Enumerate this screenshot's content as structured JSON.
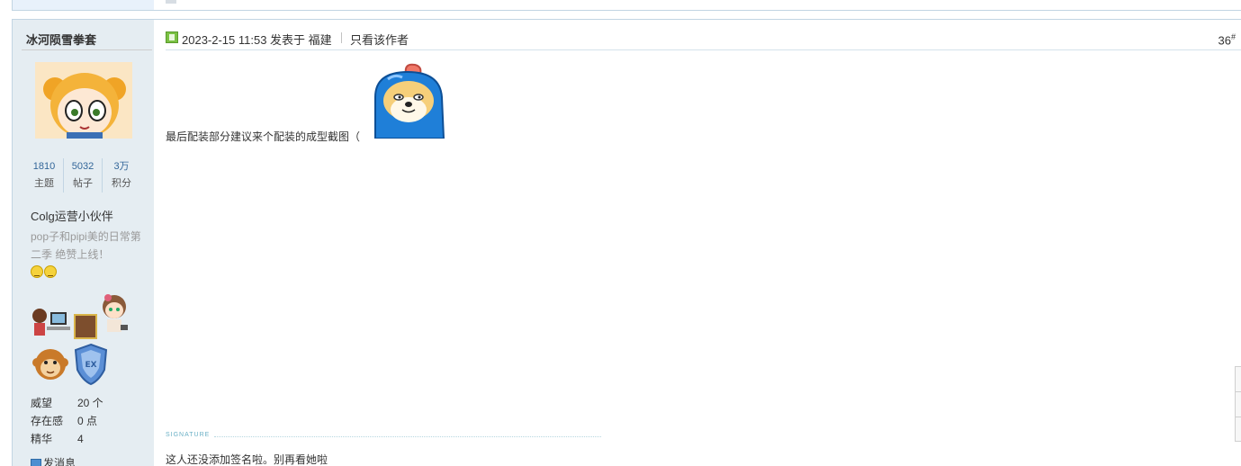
{
  "author": {
    "name": "冰河陨雪拳套",
    "stats": [
      {
        "value": "1810",
        "label": "主题"
      },
      {
        "value": "5032",
        "label": "帖子"
      },
      {
        "value": "3万",
        "label": "积分"
      }
    ],
    "group": "Colg运营小伙伴",
    "custom_title": "pop子和pipi美的日常第二季 绝赞上线！",
    "info": [
      {
        "key": "威望",
        "value": "20 个"
      },
      {
        "key": "存在感",
        "value": "0 点"
      },
      {
        "key": "精华",
        "value": "4"
      }
    ],
    "send_message": "发消息"
  },
  "post": {
    "time": "2023-2-15 11:53 发表于 福建",
    "author_only": "只看该作者",
    "floor": "36",
    "floor_mark": "#",
    "text": "最后配装部分建议来个配装的成型截图（",
    "signature_label": "SIGNATURE",
    "signature_text": "这人还没添加签名啦。别再看她啦"
  },
  "colors": {
    "sidebar_bg": "#e5edf2",
    "border": "#c2d5e3",
    "link": "#336699"
  }
}
